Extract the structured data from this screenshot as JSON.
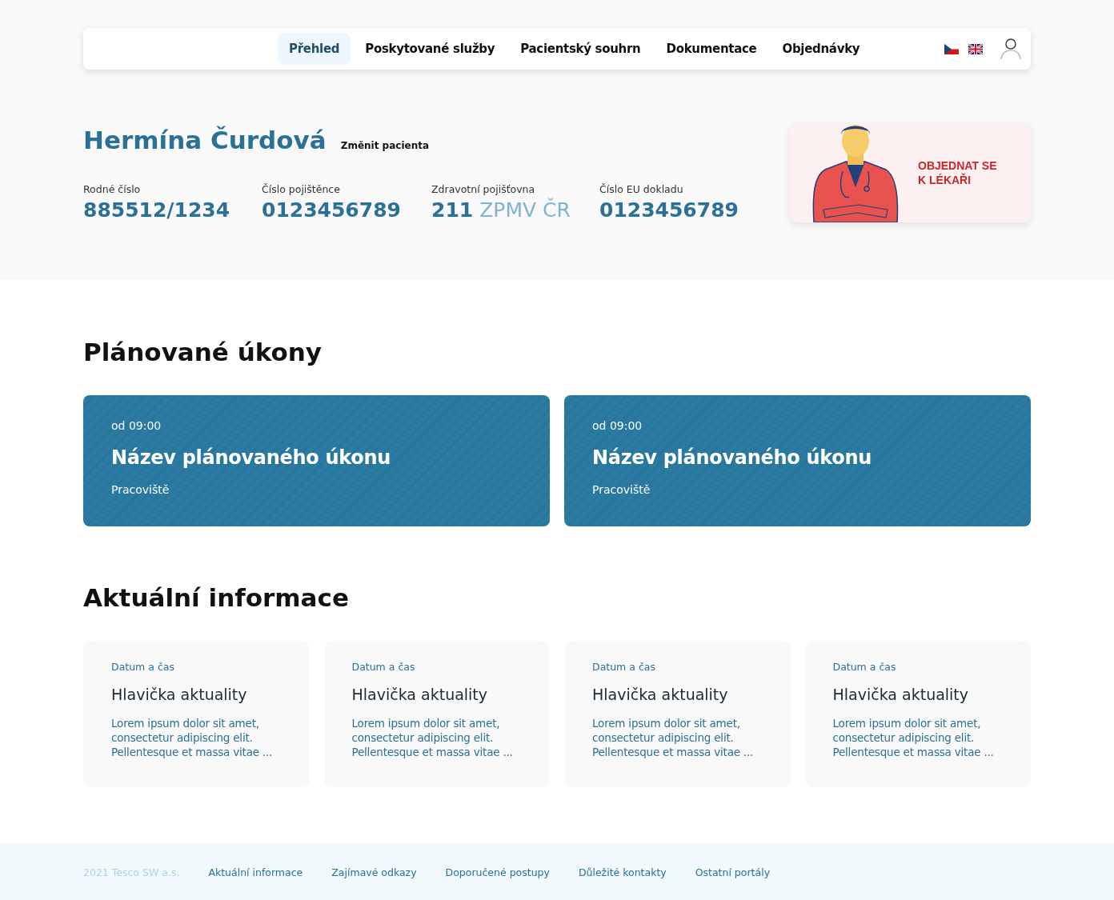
{
  "nav": {
    "tabs": [
      {
        "label": "Přehled",
        "selected": true
      },
      {
        "label": "Poskytované služby",
        "selected": false
      },
      {
        "label": "Pacientský souhrn",
        "selected": false
      },
      {
        "label": "Dokumentace",
        "selected": false
      },
      {
        "label": "Objednávky",
        "selected": false
      }
    ],
    "languages": [
      {
        "kind": "cz"
      },
      {
        "kind": "gb"
      }
    ]
  },
  "patient": {
    "name": "Hermína Čurdová",
    "change_link": "Změnit pacienta",
    "fields": [
      {
        "label": "Rodné číslo",
        "value": "885512/1234"
      },
      {
        "label": "Číslo pojištěnce",
        "value": "0123456789"
      },
      {
        "label": "Zdravotní pojišťovna",
        "value": "211",
        "note": "ZPMV ČR"
      },
      {
        "label": "Číslo EU dokladu",
        "value": "0123456789"
      }
    ]
  },
  "appointment_card": {
    "text": "OBJEDNAT SE K LÉKAŘI"
  },
  "planned": {
    "title": "Plánované úkony",
    "items": [
      {
        "time": "od 09:00",
        "name": "Název plánovaného úkonu",
        "place": "Pracoviště"
      },
      {
        "time": "od 09:00",
        "name": "Název plánovaného úkonu",
        "place": "Pracoviště"
      }
    ]
  },
  "news": {
    "title": "Aktuální informace",
    "items": [
      {
        "date": "Datum a čas",
        "headline": "Hlavička aktuality",
        "text": "Lorem ipsum dolor sit amet, consectetur adipiscing elit. Pellentesque et massa vitae ..."
      },
      {
        "date": "Datum a čas",
        "headline": "Hlavička aktuality",
        "text": "Lorem ipsum dolor sit amet, consectetur adipiscing elit. Pellentesque et massa vitae ..."
      },
      {
        "date": "Datum a čas",
        "headline": "Hlavička aktuality",
        "text": "Lorem ipsum dolor sit amet, consectetur adipiscing elit. Pellentesque et massa vitae ..."
      },
      {
        "date": "Datum a čas",
        "headline": "Hlavička aktuality",
        "text": "Lorem ipsum dolor sit amet, consectetur adipiscing elit. Pellentesque et massa vitae ..."
      }
    ]
  },
  "footer": {
    "copyright": "2021 Tesco SW a.s.",
    "links": [
      "Aktuální informace",
      "Zajímavé odkazy",
      "Doporučené postupy",
      "Důležité kontakty",
      "Ostatní portály"
    ]
  }
}
